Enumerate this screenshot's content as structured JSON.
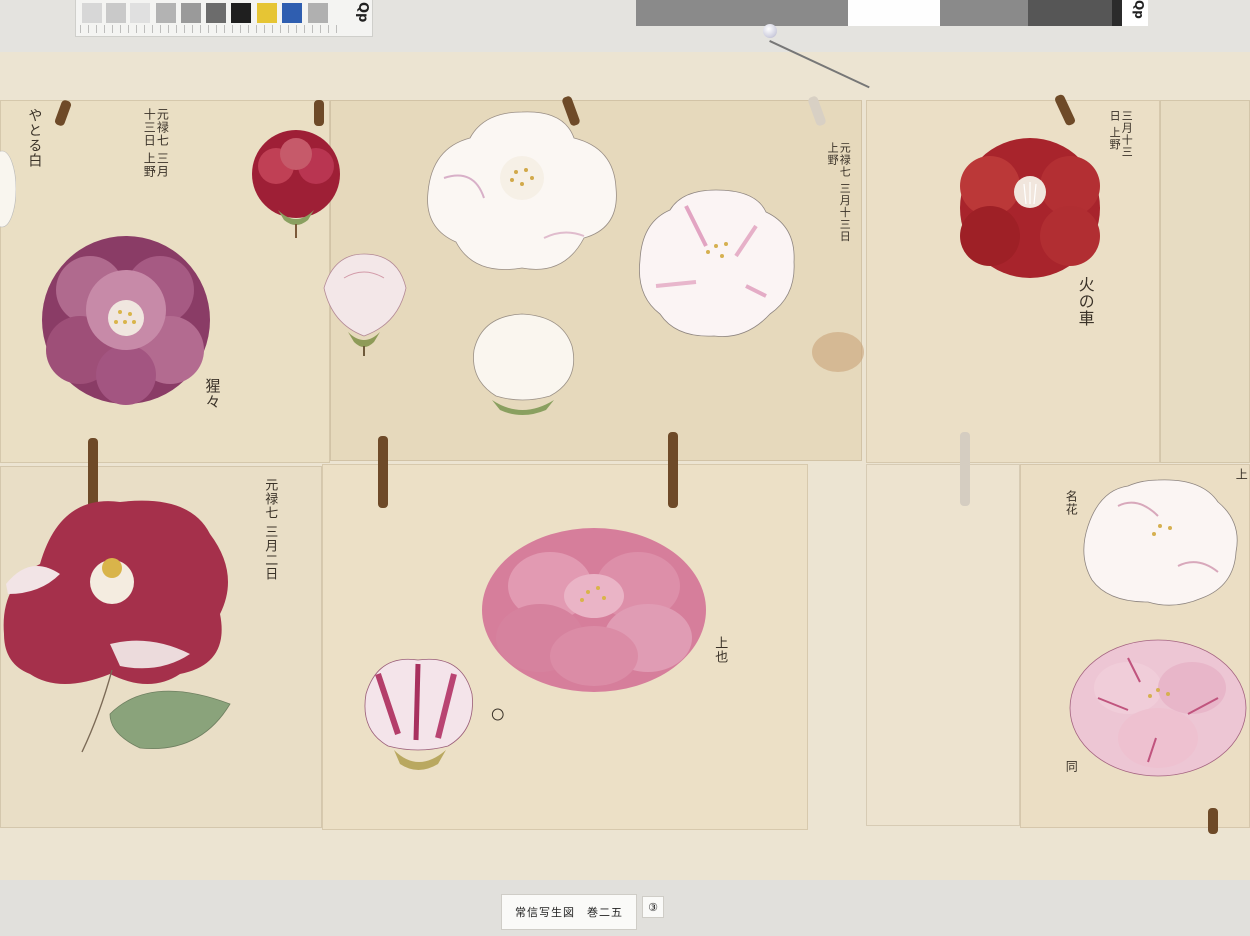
{
  "calibration": {
    "left_label": "Qp",
    "right_label": "Qp",
    "swatch_colors": [
      "#d7d7d7",
      "#c9c9c9",
      "#b3b3b3",
      "#9a9a9a",
      "#6c6c6c",
      "#4a4a4a",
      "#1f1f1f",
      "#e6c534",
      "#2f5eb0",
      "#b0b0b0"
    ],
    "gray_blocks": [
      "#8a8a8a",
      "#fefefe",
      "#8a8a8a",
      "#565656",
      "#2b2b2b"
    ]
  },
  "caption": {
    "title": "常信写生図　巻二五",
    "page_number": "③"
  },
  "inscriptions": {
    "top_left_name": "やとる白",
    "top_left_date": "元禄七 三月十三日 上野",
    "top_left_flower_name": "猩々",
    "top_mid_date": "元禄七 三月十三日 上野",
    "top_right_date": "三月十三日 上野",
    "top_right_flower_name": "火の車",
    "bottom_left_date": "元禄七 三月二日",
    "bottom_mid_note": "上也",
    "bottom_mid_mark": "〇",
    "bottom_right_note": "名花",
    "bottom_right_mark": "同",
    "bottom_right_edge": "上"
  },
  "colors": {
    "paper": "#e9dcc0",
    "mount": "#ece4d2",
    "crimson": "#a8242c",
    "magenta": "#8e3f6b",
    "pink": "#d77c9a",
    "white_petal": "#fbf7f2",
    "leaf": "#8aa37b",
    "tab": "#6e4a28"
  }
}
